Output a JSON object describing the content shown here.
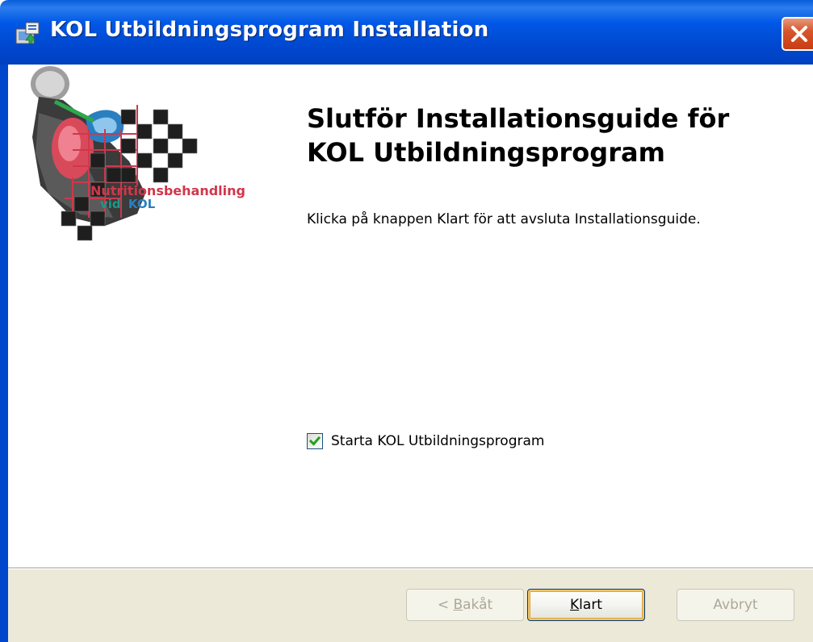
{
  "window": {
    "title": "KOL Utbildningsprogram Installation"
  },
  "logo": {
    "line1": "Nutritionsbehandling",
    "line2_a": "vid",
    "line2_b": "KOL"
  },
  "main": {
    "heading_line1": "Slutför Installationsguide för",
    "heading_line2": "KOL Utbildningsprogram",
    "description": "Klicka på knappen Klart för att avsluta Installationsguide.",
    "launch_checkbox": {
      "label": "Starta KOL Utbildningsprogram",
      "checked": true
    }
  },
  "buttons": {
    "back": {
      "prefix": "< ",
      "mnemonic": "B",
      "rest": "akåt",
      "enabled": false
    },
    "finish": {
      "mnemonic": "K",
      "rest": "lart",
      "enabled": true,
      "default": true
    },
    "cancel": {
      "label": "Avbryt",
      "enabled": false
    }
  },
  "colors": {
    "titlebar": "#0058e6",
    "footer": "#ece9d8",
    "logo_red": "#d0374a",
    "logo_teal": "#1a9a8a"
  }
}
